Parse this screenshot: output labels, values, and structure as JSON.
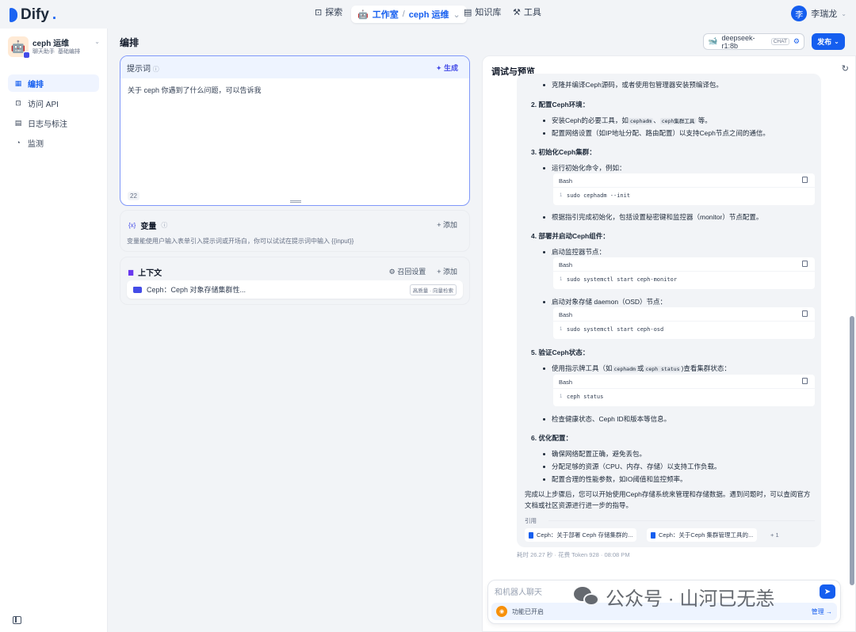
{
  "brand": {
    "name": "Dify",
    "suffix": "."
  },
  "nav": {
    "explore": "探索",
    "studio": "工作室",
    "app": "ceph 运维",
    "knowledge": "知识库",
    "tools": "工具"
  },
  "user": {
    "initial": "李",
    "name": "李瑞龙"
  },
  "app": {
    "icon": "🤖",
    "name": "ceph 运维",
    "tags": [
      "聊天助手",
      "基础编排"
    ]
  },
  "sidebar": {
    "items": [
      {
        "label": "编排"
      },
      {
        "label": "访问 API"
      },
      {
        "label": "日志与标注"
      },
      {
        "label": "监测"
      }
    ]
  },
  "page": {
    "title": "编排"
  },
  "model": {
    "name": "deepseek-r1:8b",
    "mode": "CHAT"
  },
  "publish": {
    "label": "发布"
  },
  "prompt": {
    "title": "提示词",
    "generate": "生成",
    "text": "关于 ceph 你遇到了什么问题，可以告诉我",
    "count": "22"
  },
  "variables": {
    "title": "变量",
    "add": "添加",
    "desc": "变量能使用户输入表单引入提示词或开场白，你可以试试在提示词中输入 {{input}}"
  },
  "context": {
    "title": "上下文",
    "recall": "召回设置",
    "add": "添加",
    "item": "Ceph：Ceph 对象存储集群性...",
    "tag": "高质量 · 向量检索"
  },
  "debug": {
    "title": "调试与预览",
    "lines": {
      "l1": "克隆并编译Ceph源码，或者使用包管理器安装预编译包。",
      "h2": "2. 配置Ceph环境：",
      "l2a_pre": "安装Ceph的必要工具，如",
      "l2a_c1": "cephadm",
      "l2a_mid": "、",
      "l2a_c2": "ceph集群工具",
      "l2a_post": "等。",
      "l2b": "配置网络设置（如IP地址分配、路由配置）以支持Ceph节点之间的通信。",
      "h3": "3. 初始化Ceph集群：",
      "l3a": "运行初始化命令，例如：",
      "l3b": "根据指引完成初始化，包括设置秘密键和监控器（monitor）节点配置。",
      "h4": "4. 部署并启动Ceph组件：",
      "l4a": "启动监控器节点：",
      "l4b": "启动对象存储 daemon（OSD）节点：",
      "h5": "5. 验证Ceph状态：",
      "l5a_pre": "使用指示牌工具（如",
      "l5a_c1": "cephadm",
      "l5a_mid": "或",
      "l5a_c2": "ceph status",
      "l5a_post": ")查看集群状态：",
      "l5b": "检查健康状态、Ceph ID和版本等信息。",
      "h6": "6. 优化配置：",
      "l6a": "确保网络配置正确，避免丢包。",
      "l6b": "分配足够的资源（CPU、内存、存储）以支持工作负载。",
      "l6c": "配置合理的性能参数，如IO阈值和监控频率。"
    },
    "code": [
      {
        "lang": "Bash",
        "num": "1",
        "code": "sudo cephadm --init"
      },
      {
        "lang": "Bash",
        "num": "1",
        "code": "sudo systemctl start ceph-monitor"
      },
      {
        "lang": "Bash",
        "num": "1",
        "code": "sudo systemctl start ceph-osd"
      },
      {
        "lang": "Bash",
        "num": "1",
        "code": "ceph status"
      }
    ],
    "summary": "完成以上步骤后，您可以开始使用Ceph存储系统来管理和存储数据。遇到问题时，可以查阅官方文档或社区资源进行进一步的指导。",
    "cite_label": "引用",
    "citations": [
      "Ceph：关于部署 Ceph 存储集群的...",
      "Ceph：关于Ceph 集群管理工具的..."
    ],
    "cite_more": "+ 1",
    "meta": "耗时 26.27 秒 · 花费 Token 928 · 08:08 PM"
  },
  "chat": {
    "placeholder": "和机器人聊天",
    "feature": "功能已开启",
    "manage": "管理"
  },
  "watermark": "公众号 · 山河已无恙"
}
